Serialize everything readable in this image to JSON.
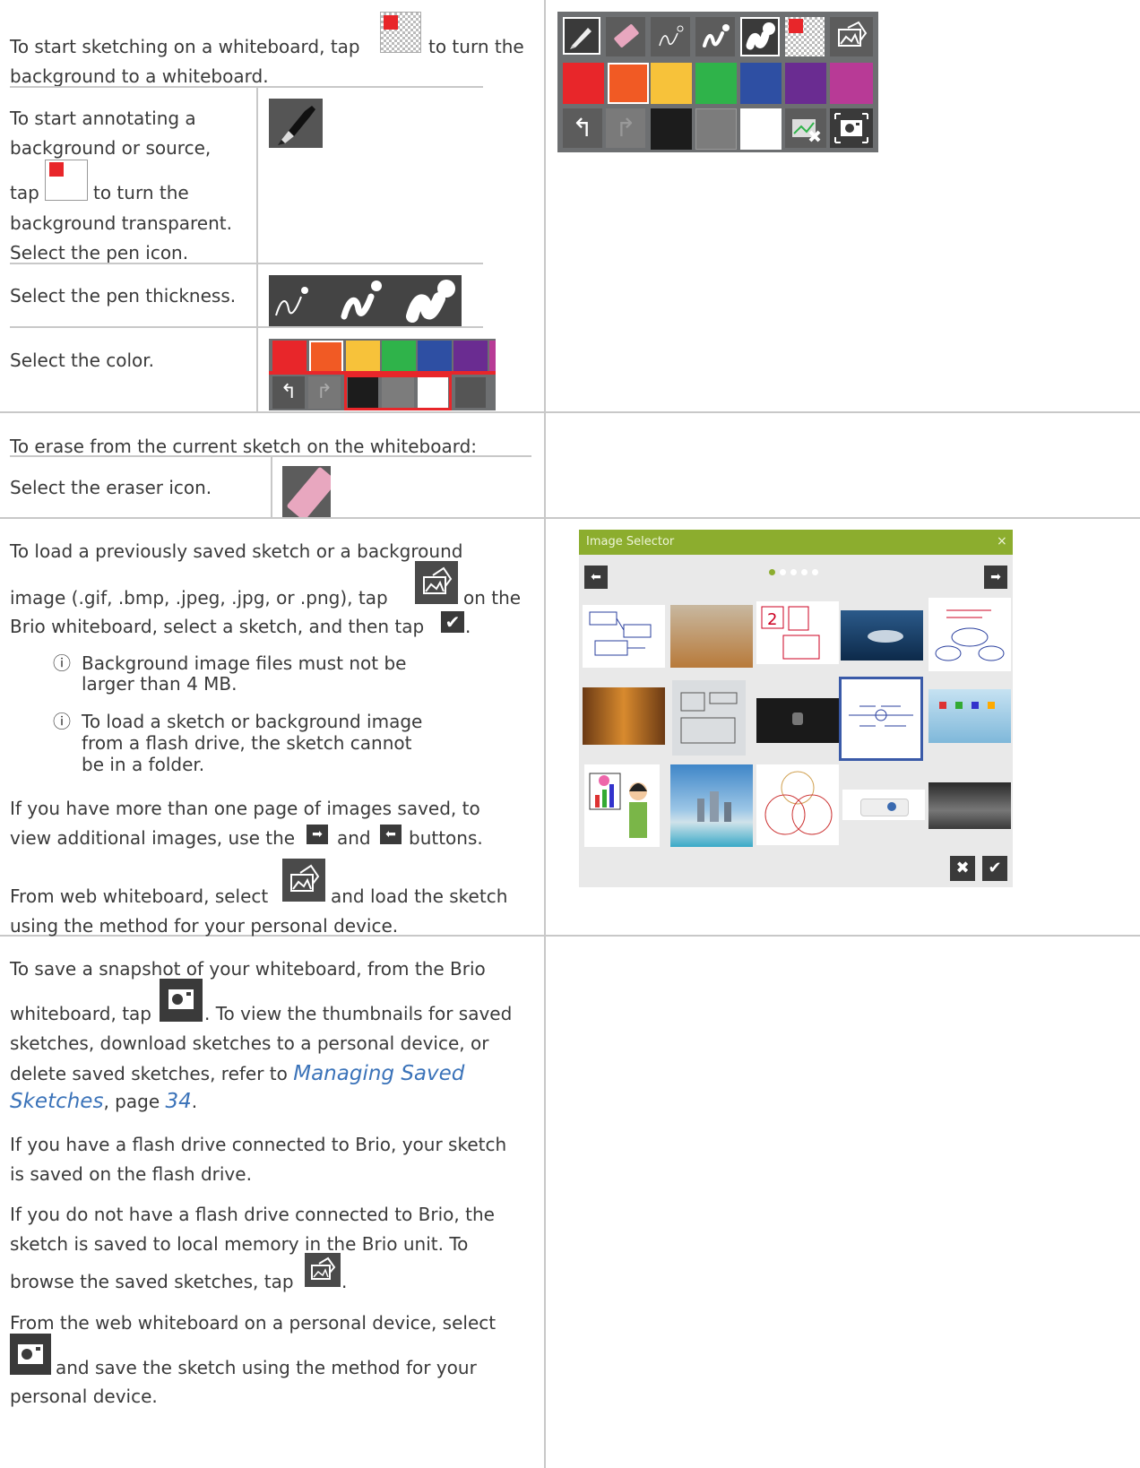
{
  "row1": {
    "intro_line1": "To start sketching on a whiteboard, tap",
    "intro_line1_end": "to turn the",
    "intro_line2": "background to a whiteboard.",
    "annot": [
      "To start annotating a",
      "background or source,"
    ],
    "annot_tap": "tap",
    "annot_tap_end": "to turn the",
    "annot_rest": [
      "background transparent.",
      "Select the pen icon."
    ],
    "thickness": "Select the pen thickness.",
    "color": "Select the color."
  },
  "row2": {
    "heading": "To erase from the current sketch on the whiteboard:",
    "eraser": "Select the eraser icon."
  },
  "row3": {
    "p1_l1": "To load a previously saved sketch or a background",
    "p1_l2a": "image (.gif, .bmp, .jpeg, .jpg, or .png), tap",
    "p1_l2b": "on the",
    "p1_l3": "Brio whiteboard, select a sketch, and then tap",
    "p1_l3_end": ".",
    "note1": [
      "Background image files must not be",
      "larger than 4 MB."
    ],
    "note2": [
      "To load a sketch or background image",
      "from a flash drive, the sketch cannot",
      "be in a folder."
    ],
    "p2_l1": "If you have more than one page of images saved, to",
    "p2_l2a": "view additional images, use the",
    "p2_l2b": "and",
    "p2_l2c": "buttons.",
    "p3_l1a": "From web whiteboard, select",
    "p3_l1b": "and load the sketch",
    "p3_l2": "using the method for your personal device.",
    "selector_title": "Image Selector",
    "selector_close": "×",
    "page_dots": 5,
    "page_active": 1
  },
  "row4": {
    "p1_l1": "To save a snapshot of your whiteboard, from the Brio",
    "p1_l2a": "whiteboard, tap",
    "p1_l2b": ". To view the thumbnails for saved",
    "p1_l3": "sketches, download sketches to a personal device, or",
    "p1_l4": "delete saved sketches, refer to",
    "link_a": "Managing Saved",
    "link_b": "Sketches",
    "page_prefix": ", page",
    "page_num": "34",
    "period": ".",
    "p2": [
      "If you have a flash drive connected to Brio, your sketch",
      "is saved on the flash drive."
    ],
    "p3": [
      "If you do not have a flash drive connected to Brio, the",
      "sketch is saved to local memory in the Brio unit. To"
    ],
    "p3_l3a": "browse the saved sketches, tap",
    "p3_l3b": ".",
    "p4_l1": "From the web whiteboard on a personal device, select",
    "p4_l2": "and save the sketch using the method for your",
    "p4_l3": "personal device."
  },
  "colors": {
    "red": "#e8262a",
    "orange": "#f15a24",
    "yellow": "#f7c23a",
    "green": "#2fb34a",
    "blue": "#2e4fa3",
    "purple": "#6a2c91",
    "magenta": "#b83a96",
    "black": "#1c1c1c",
    "gray": "#7c7c7c",
    "white": "#ffffff",
    "toolbar_bg": "#6d6f71",
    "selector_header": "#8cad2e",
    "selector_bg": "#e9e9e9"
  }
}
